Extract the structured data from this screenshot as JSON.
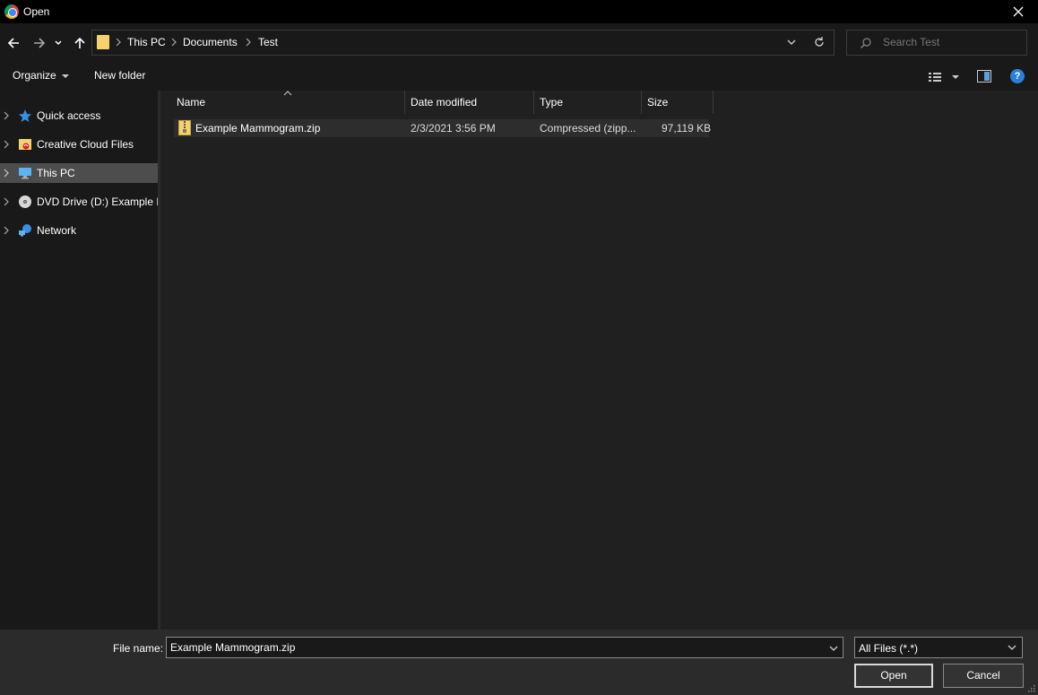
{
  "window": {
    "title": "Open"
  },
  "address": {
    "crumbs": [
      "This PC",
      "Documents",
      "Test"
    ]
  },
  "search": {
    "placeholder": "Search Test"
  },
  "toolbar": {
    "organize_label": "Organize",
    "new_folder_label": "New folder",
    "help_label": "?"
  },
  "nav": {
    "items": [
      {
        "label": "Quick access",
        "icon": "star-icon",
        "selected": false
      },
      {
        "label": "Creative Cloud Files",
        "icon": "creative-cloud-folder-icon",
        "selected": false
      },
      {
        "label": "This PC",
        "icon": "computer-icon",
        "selected": true
      },
      {
        "label": "DVD Drive (D:) Example Mammogram",
        "icon": "dvd-drive-icon",
        "selected": false
      },
      {
        "label": "Network",
        "icon": "network-icon",
        "selected": false
      }
    ]
  },
  "columns": {
    "name": "Name",
    "date": "Date modified",
    "type": "Type",
    "size": "Size"
  },
  "files": [
    {
      "name": "Example Mammogram.zip",
      "date": "2/3/2021 3:56 PM",
      "type": "Compressed (zipp...",
      "size": "97,119 KB",
      "icon": "zip-folder-icon"
    }
  ],
  "footer": {
    "file_name_label": "File name:",
    "file_name_value": "Example Mammogram.zip",
    "file_type_value": "All Files (*.*)",
    "open_label": "Open",
    "cancel_label": "Cancel"
  },
  "colors": {
    "selection": "#4d4d4d",
    "row_highlight": "#2d2d2d",
    "folder": "#f5d26c",
    "help": "#2b7fd9"
  }
}
